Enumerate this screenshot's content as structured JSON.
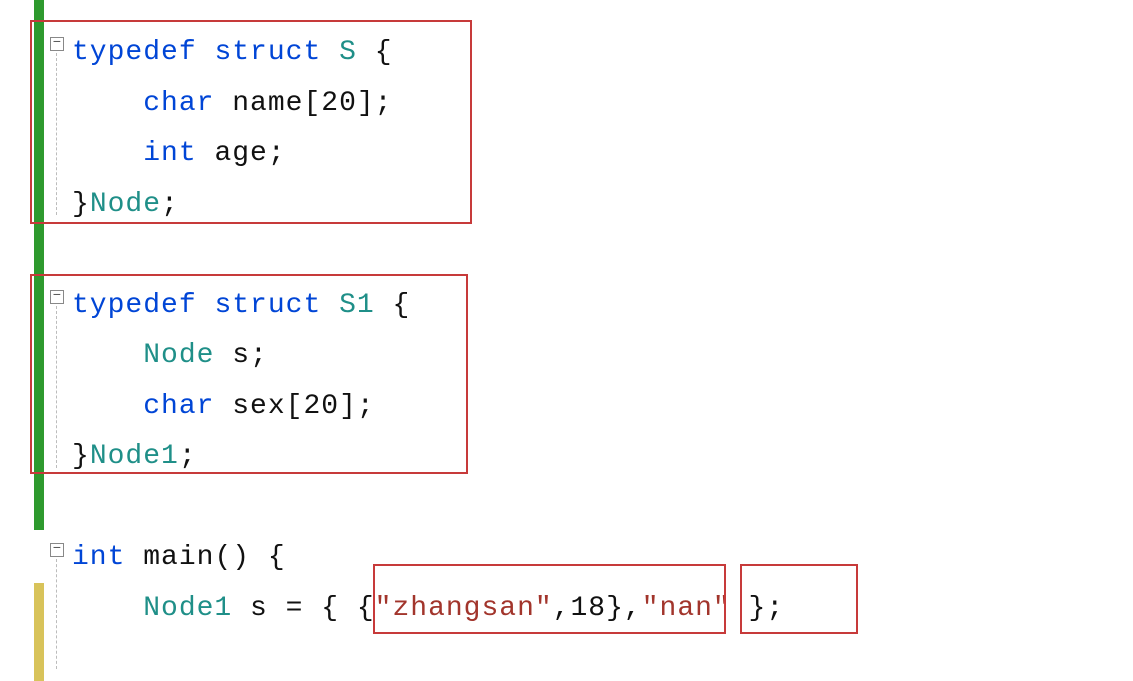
{
  "code": {
    "l1": {
      "kw_typedef": "typedef",
      "sp1": " ",
      "kw_struct": "struct",
      "sp2": " ",
      "type": "S",
      "sp3": " ",
      "brace": "{"
    },
    "l2": {
      "indent": "    ",
      "kw_char": "char",
      "sp": " ",
      "rest": "name[20];"
    },
    "l3": {
      "indent": "    ",
      "kw_int": "int",
      "sp": " ",
      "rest": "age;"
    },
    "l4": {
      "brace": "}",
      "type": "Node",
      "semi": ";"
    },
    "l5": {
      "blank": ""
    },
    "l6": {
      "kw_typedef": "typedef",
      "sp1": " ",
      "kw_struct": "struct",
      "sp2": " ",
      "type": "S1",
      "sp3": " ",
      "brace": "{"
    },
    "l7": {
      "indent": "    ",
      "type": "Node",
      "sp": " ",
      "rest": "s;"
    },
    "l8": {
      "indent": "    ",
      "kw_char": "char",
      "sp": " ",
      "rest": "sex[20];"
    },
    "l9": {
      "brace": "}",
      "type": "Node1",
      "semi": ";"
    },
    "l10": {
      "blank": ""
    },
    "l11": {
      "kw_int": "int",
      "sp": " ",
      "main": "main() {"
    },
    "l12": {
      "indent": "    ",
      "type": "Node1",
      "sp": " ",
      "var": "s = { {",
      "str1": "\"zhangsan\"",
      "mid": ",18},",
      "str2": "\"nan\"",
      "end": " };"
    }
  },
  "annotations": {
    "box1": "struct-S-definition",
    "box2": "struct-S1-definition",
    "box3": "initializer-inner",
    "box4": "initializer-sex"
  }
}
